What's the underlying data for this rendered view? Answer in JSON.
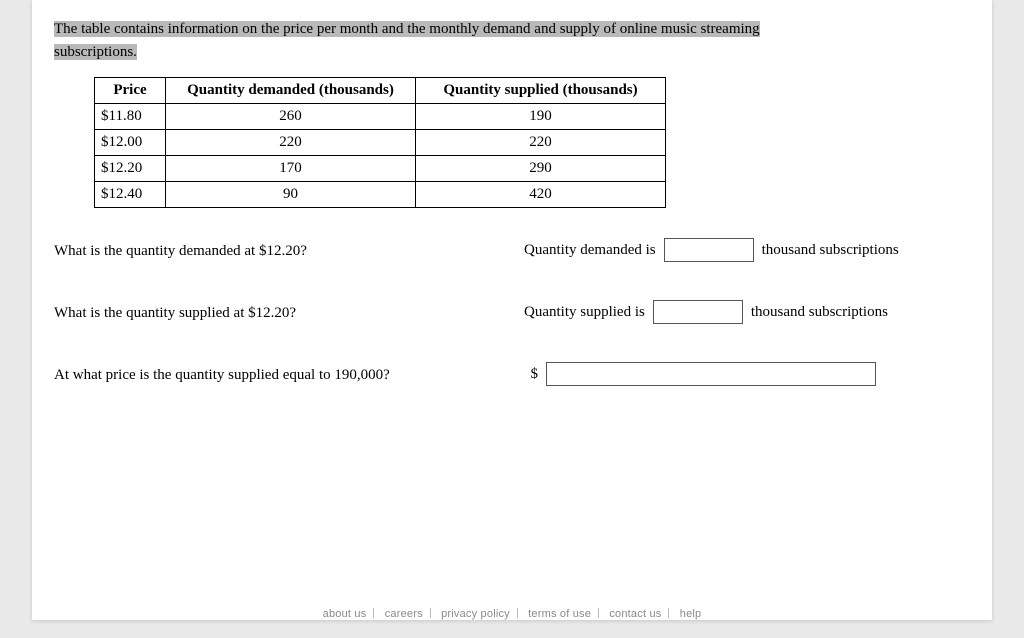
{
  "intro": {
    "line1": "The table contains information on the price per month and the monthly demand and supply of online music streaming",
    "line2": "subscriptions."
  },
  "table": {
    "headers": {
      "price": "Price",
      "qd": "Quantity demanded (thousands)",
      "qs": "Quantity supplied (thousands)"
    },
    "rows": [
      {
        "price": "$11.80",
        "qd": "260",
        "qs": "190"
      },
      {
        "price": "$12.00",
        "qd": "220",
        "qs": "220"
      },
      {
        "price": "$12.20",
        "qd": "170",
        "qs": "290"
      },
      {
        "price": "$12.40",
        "qd": "90",
        "qs": "420"
      }
    ]
  },
  "q1": {
    "question": "What is the quantity demanded at $12.20?",
    "answer_prefix": "Quantity demanded is",
    "answer_suffix": "thousand subscriptions"
  },
  "q2": {
    "question": "What is the quantity supplied at $12.20?",
    "answer_prefix": "Quantity supplied is",
    "answer_suffix": "thousand subscriptions"
  },
  "q3": {
    "question": "At what price is the quantity supplied equal to 190,000?",
    "answer_prefix": "$"
  },
  "footer": {
    "about": "about us",
    "careers": "careers",
    "privacy": "privacy policy",
    "terms": "terms of use",
    "contact": "contact us",
    "help": "help"
  }
}
